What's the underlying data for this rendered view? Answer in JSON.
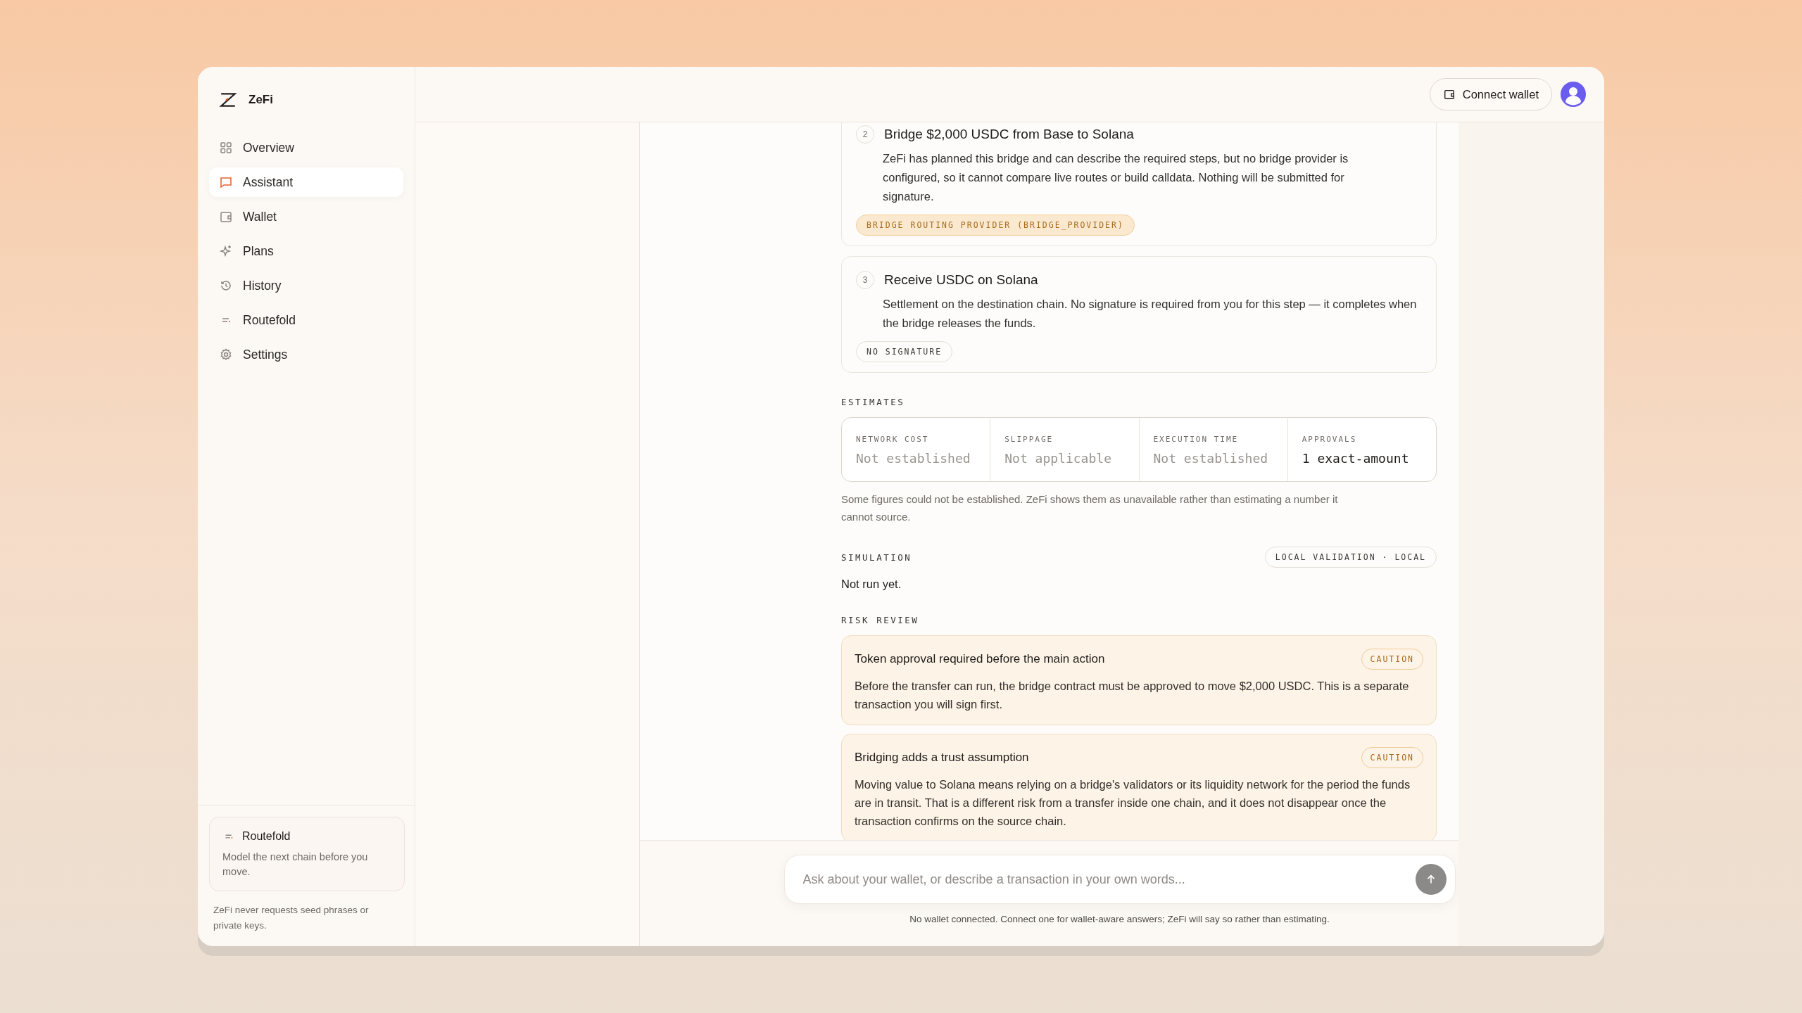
{
  "brand": {
    "name": "ZeFi"
  },
  "sidebar": {
    "items": [
      {
        "label": "Overview",
        "kind": "grid",
        "selected": false
      },
      {
        "label": "Assistant",
        "kind": "chat",
        "selected": true
      },
      {
        "label": "Wallet",
        "kind": "wallet",
        "selected": false
      },
      {
        "label": "Plans",
        "kind": "sparkle",
        "selected": false
      },
      {
        "label": "History",
        "kind": "history",
        "selected": false
      },
      {
        "label": "Routefold",
        "kind": "route",
        "selected": false
      },
      {
        "label": "Settings",
        "kind": "gear",
        "selected": false
      }
    ],
    "promo": {
      "title": "Routefold",
      "text": "Model the next chain before you move."
    },
    "footer": "ZeFi never requests seed phrases or private keys."
  },
  "header": {
    "connect_button": "Connect wallet"
  },
  "steps": [
    {
      "number": "2",
      "title": "Bridge $2,000 USDC from Base to Solana",
      "text": "ZeFi has planned this bridge and can describe the required steps, but no bridge provider is configured, so it cannot compare live routes or build calldata. Nothing will be submitted for signature.",
      "tag": "BRIDGE ROUTING PROVIDER (BRIDGE_PROVIDER)",
      "kind": "warning"
    },
    {
      "number": "3",
      "title": "Receive USDC on Solana",
      "text": "Settlement on the destination chain. No signature is required from you for this step — it completes when the bridge releases the funds.",
      "tag": "NO SIGNATURE",
      "kind": "neutral"
    }
  ],
  "estimates": {
    "heading": "ESTIMATES",
    "items": [
      {
        "label": "NETWORK COST",
        "value": "Not established",
        "established": false
      },
      {
        "label": "SLIPPAGE",
        "value": "Not applicable",
        "established": false
      },
      {
        "label": "EXECUTION TIME",
        "value": "Not established",
        "established": false
      },
      {
        "label": "APPROVALS",
        "value": "1 exact-amount",
        "established": true
      }
    ],
    "note": "Some figures could not be established. ZeFi shows them as unavailable rather than estimating a number it cannot source."
  },
  "simulation": {
    "heading": "SIMULATION",
    "badge": "LOCAL VALIDATION · LOCAL",
    "text": "Not run yet."
  },
  "risk_review": {
    "heading": "RISK REVIEW",
    "items": [
      {
        "title": "Token approval required before the main action",
        "badge": "CAUTION",
        "kind": "caution",
        "text": "Before the transfer can run, the bridge contract must be approved to move $2,000 USDC. This is a separate transaction you will sign first."
      },
      {
        "title": "Bridging adds a trust assumption",
        "badge": "CAUTION",
        "kind": "caution",
        "text": "Moving value to Solana means relying on a bridge's validators or its liquidity network for the period the funds are in transit. That is a different risk from a transfer inside one chain, and it does not disappear once the transaction confirms on the source chain."
      }
    ]
  },
  "composer": {
    "placeholder": "Ask about your wallet, or describe a transaction in your own words...",
    "note": "No wallet connected. Connect one for wallet-aware answers; ZeFi will say so rather than estimating."
  }
}
